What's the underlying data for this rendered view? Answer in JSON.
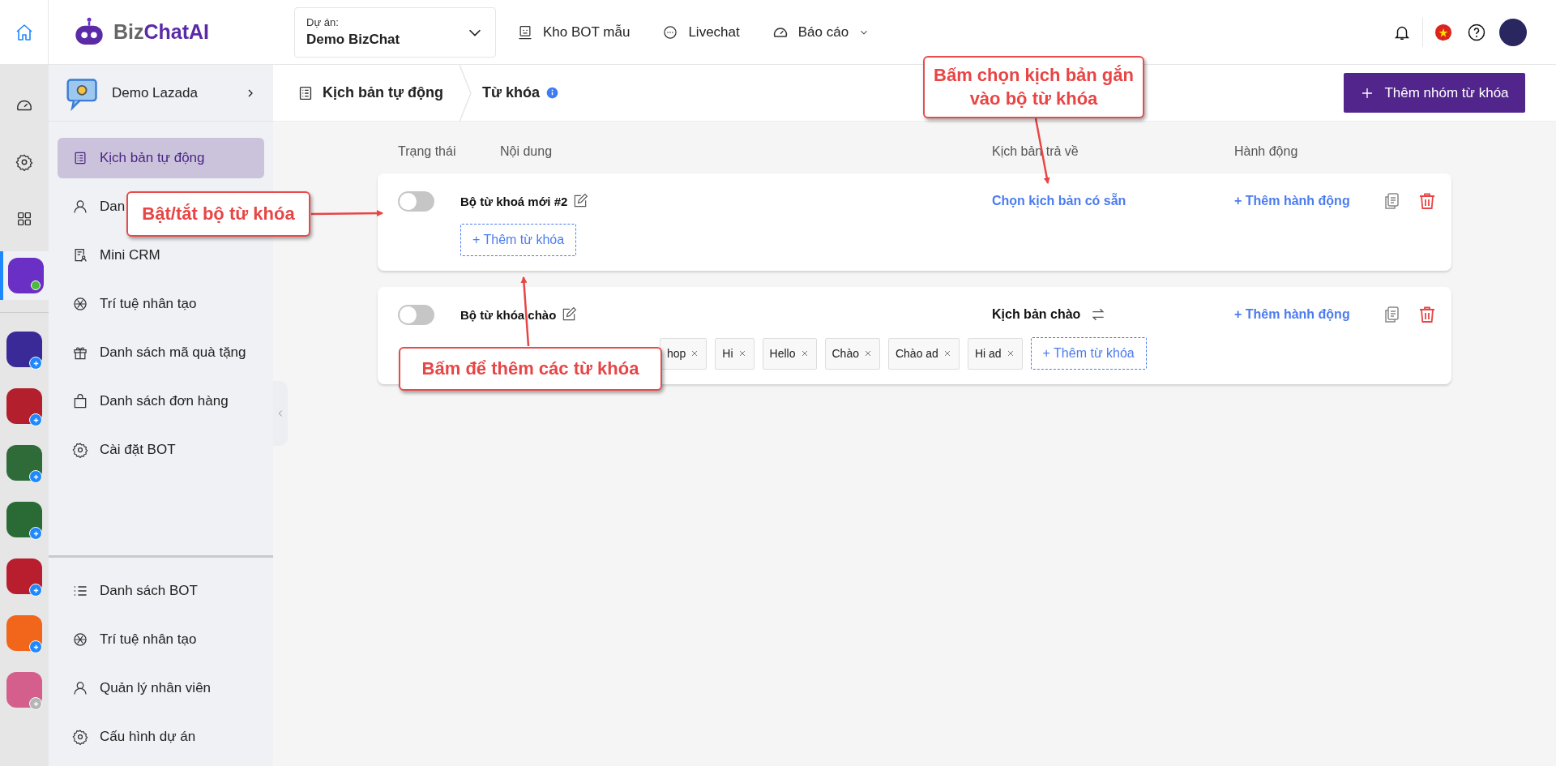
{
  "header": {
    "logo": {
      "text_1": "Biz",
      "text_2": "ChatAI"
    },
    "project": {
      "label": "Dự án:",
      "value": "Demo BizChat"
    },
    "nav": [
      {
        "label": "Kho BOT mẫu",
        "dropdown": false
      },
      {
        "label": "Livechat",
        "dropdown": false
      },
      {
        "label": "Báo cáo",
        "dropdown": true
      }
    ]
  },
  "rail": {
    "apps": [
      {
        "color": "#6a2fc4",
        "selected": true,
        "kind": "online"
      },
      {
        "color": "#3a2a98",
        "selected": false,
        "kind": "add"
      },
      {
        "color": "#b31f2c",
        "selected": false,
        "kind": "add"
      },
      {
        "color": "#2e6b38",
        "selected": false,
        "kind": "add"
      },
      {
        "color": "#2a6a34",
        "selected": false,
        "kind": "add"
      },
      {
        "color": "#b81e2e",
        "selected": false,
        "kind": "add"
      },
      {
        "color": "#f2661c",
        "selected": false,
        "kind": "add"
      },
      {
        "color": "#d45f8c",
        "selected": false,
        "kind": "muted"
      }
    ]
  },
  "sidebar": {
    "bot_name": "Demo Lazada",
    "items": [
      {
        "label": "Kịch bản tự động",
        "selected": true
      },
      {
        "label": "Dan",
        "selected": false
      },
      {
        "label": "Mini CRM",
        "selected": false
      },
      {
        "label": "Trí tuệ nhân tạo",
        "selected": false
      },
      {
        "label": "Danh sách mã quà tặng",
        "selected": false
      },
      {
        "label": "Danh sách đơn hàng",
        "selected": false
      },
      {
        "label": "Cài đặt BOT",
        "selected": false
      }
    ],
    "bottom_items": [
      {
        "label": "Danh sách BOT"
      },
      {
        "label": "Trí tuệ nhân tạo"
      },
      {
        "label": "Quản lý nhân viên"
      },
      {
        "label": "Cấu hình dự án"
      }
    ]
  },
  "breadcrumb": {
    "parent": "Kịch bản tự động",
    "current": "Từ khóa"
  },
  "add_group_button": "Thêm nhóm từ khóa",
  "table": {
    "columns": [
      "Trạng thái",
      "Nội dung",
      "Kịch bản trả về",
      "Hành động"
    ],
    "rows": [
      {
        "name": "Bộ từ khoá mới #2",
        "on": false,
        "keywords": [],
        "add_keyword": "+ Thêm từ khóa",
        "script": {
          "kind": "link",
          "text": "Chọn kịch bản có sẵn"
        },
        "action": "+ Thêm hành động"
      },
      {
        "name": "Bộ từ khóa chào",
        "on": false,
        "keywords": [
          "hop",
          "Hi",
          "Hello",
          "Chào",
          "Chào ad",
          "Hi ad"
        ],
        "add_keyword": "+ Thêm từ khóa",
        "script": {
          "kind": "assigned",
          "text": "Kịch bản chào"
        },
        "action": "+ Thêm hành động"
      }
    ]
  },
  "annotations": [
    {
      "text": "Bấm chọn kịch bản gắn vào bộ từ khóa"
    },
    {
      "text": "Bật/tắt bộ từ khóa"
    },
    {
      "text": "Bấm để thêm các từ khóa"
    }
  ]
}
